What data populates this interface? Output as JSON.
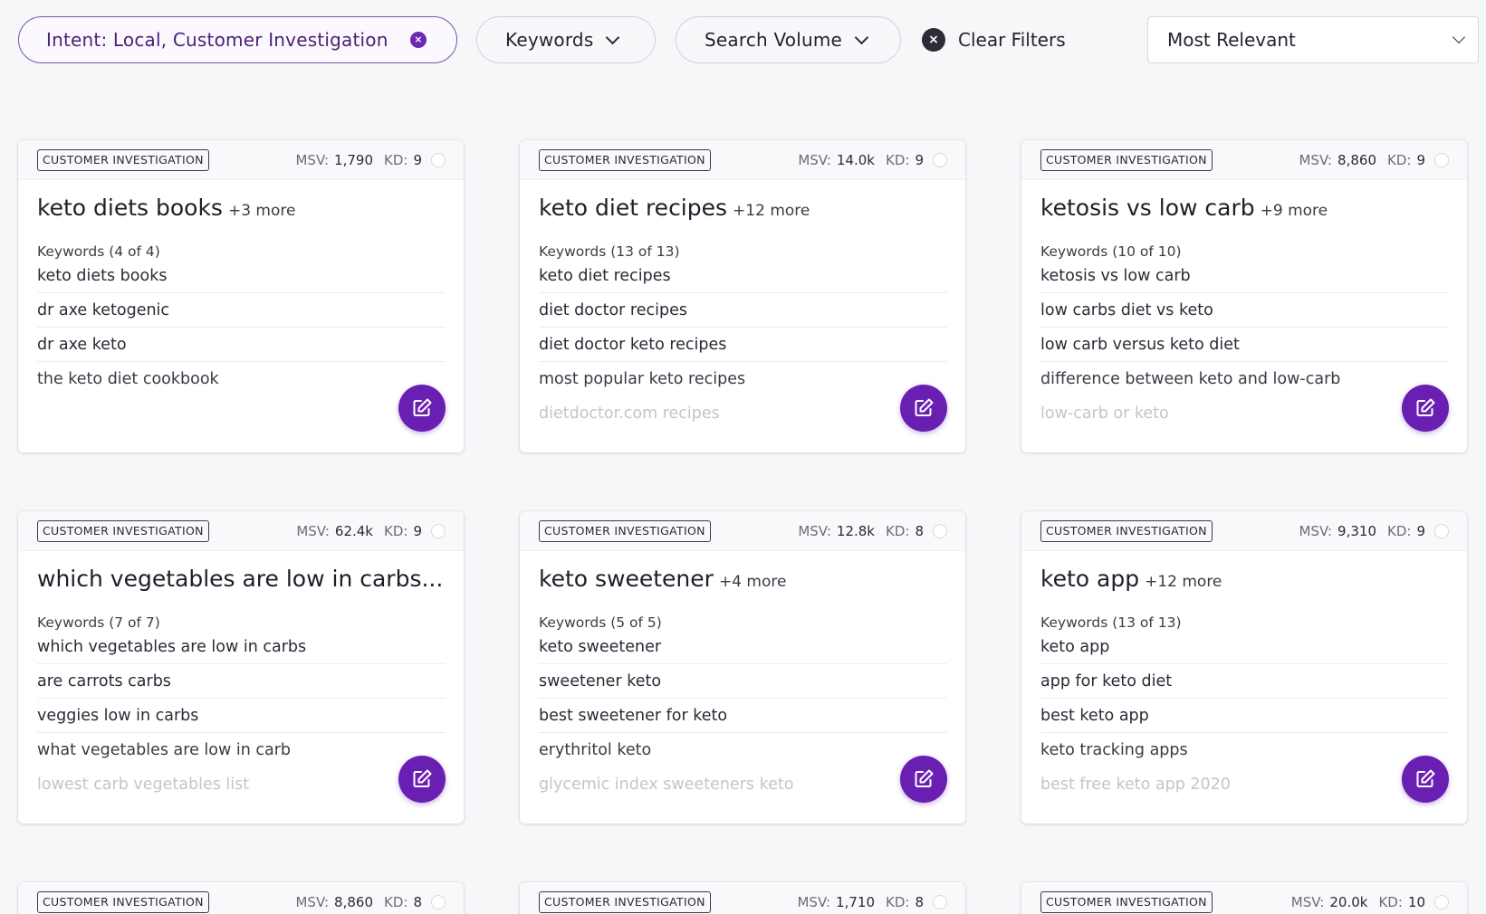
{
  "filters": {
    "intent_label": "Intent: Local, Customer Investigation",
    "intent_clear_glyph": "×",
    "keywords_label": "Keywords",
    "volume_label": "Search Volume",
    "clear_label": "Clear Filters",
    "clear_glyph": "×",
    "sort_value": "Most Relevant"
  },
  "colors": {
    "accent": "#6a1fb3",
    "intent_text": "#4a2178",
    "background": "#f6f7f9"
  },
  "cards": [
    {
      "badge": "CUSTOMER INVESTIGATION",
      "msv_label": "MSV:",
      "msv": "1,790",
      "kd_label": "KD:",
      "kd": "9",
      "title": "keto diets books",
      "more": "+3 more",
      "count": "Keywords (4 of 4)",
      "keywords": [
        "keto diets books",
        "dr axe ketogenic",
        "dr axe keto",
        "the keto diet cookbook"
      ]
    },
    {
      "badge": "CUSTOMER INVESTIGATION",
      "msv_label": "MSV:",
      "msv": "14.0k",
      "kd_label": "KD:",
      "kd": "9",
      "title": "keto diet recipes",
      "more": "+12 more",
      "count": "Keywords (13 of 13)",
      "keywords": [
        "keto diet recipes",
        "diet doctor recipes",
        "diet doctor keto recipes",
        "most popular keto recipes",
        "dietdoctor.com recipes"
      ]
    },
    {
      "badge": "CUSTOMER INVESTIGATION",
      "msv_label": "MSV:",
      "msv": "8,860",
      "kd_label": "KD:",
      "kd": "9",
      "title": "ketosis vs low carb",
      "more": "+9 more",
      "count": "Keywords (10 of 10)",
      "keywords": [
        "ketosis vs low carb",
        "low carbs diet vs keto",
        "low carb versus keto diet",
        "difference between keto and low-carb",
        "low-carb or keto"
      ]
    },
    {
      "badge": "CUSTOMER INVESTIGATION",
      "msv_label": "MSV:",
      "msv": "62.4k",
      "kd_label": "KD:",
      "kd": "9",
      "title": "which vegetables are low in carbs...",
      "more": "",
      "count": "Keywords (7 of 7)",
      "keywords": [
        "which vegetables are low in carbs",
        "are carrots carbs",
        "veggies low in carbs",
        "what vegetables are low in carb",
        "lowest carb vegetables list"
      ]
    },
    {
      "badge": "CUSTOMER INVESTIGATION",
      "msv_label": "MSV:",
      "msv": "12.8k",
      "kd_label": "KD:",
      "kd": "8",
      "title": "keto sweetener",
      "more": "+4 more",
      "count": "Keywords (5 of 5)",
      "keywords": [
        "keto sweetener",
        "sweetener keto",
        "best sweetener for keto",
        "erythritol keto",
        "glycemic index sweeteners keto"
      ]
    },
    {
      "badge": "CUSTOMER INVESTIGATION",
      "msv_label": "MSV:",
      "msv": "9,310",
      "kd_label": "KD:",
      "kd": "9",
      "title": "keto app",
      "more": "+12 more",
      "count": "Keywords (13 of 13)",
      "keywords": [
        "keto app",
        "app for keto diet",
        "best keto app",
        "keto tracking apps",
        "best free keto app 2020"
      ]
    }
  ],
  "partial_cards": [
    {
      "badge": "CUSTOMER INVESTIGATION",
      "msv_label": "MSV:",
      "msv": "8,860",
      "kd_label": "KD:",
      "kd": "8"
    },
    {
      "badge": "CUSTOMER INVESTIGATION",
      "msv_label": "MSV:",
      "msv": "1,710",
      "kd_label": "KD:",
      "kd": "8"
    },
    {
      "badge": "CUSTOMER INVESTIGATION",
      "msv_label": "MSV:",
      "msv": "20.0k",
      "kd_label": "KD:",
      "kd": "10"
    }
  ]
}
